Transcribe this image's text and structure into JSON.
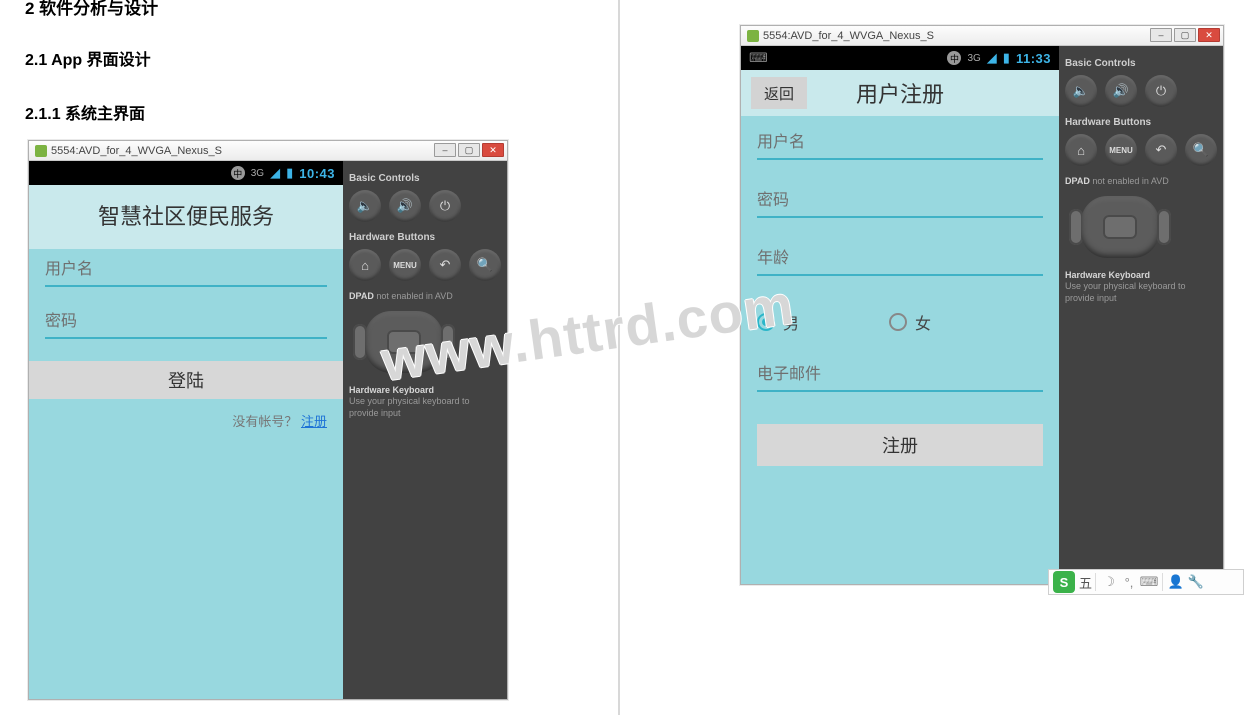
{
  "doc": {
    "section2_partial": "2 软件分析与设计",
    "h21": "2.1 App 界面设计",
    "h211": "2.1.1  系统主界面"
  },
  "emulator": {
    "window_title": "5554:AVD_for_4_WVGA_Nexus_S",
    "basic_controls_label": "Basic Controls",
    "hardware_buttons_label": "Hardware Buttons",
    "dpad_label": "DPAD",
    "dpad_disabled": "not enabled in AVD",
    "hw_kbd_label": "Hardware Keyboard",
    "hw_kbd_hint": "Use your physical keyboard to provide input",
    "menu_btn": "MENU"
  },
  "screen1": {
    "statusbar": {
      "ime": "中",
      "net": "3G",
      "clock": "10:43"
    },
    "title": "智慧社区便民服务",
    "username_ph": "用户名",
    "password_ph": "密码",
    "login_btn": "登陆",
    "no_account": "没有帐号？",
    "register_link": "注册"
  },
  "screen2": {
    "statusbar": {
      "ime": "中",
      "net": "3G",
      "clock": "11:33"
    },
    "back_btn": "返回",
    "title": "用户注册",
    "username_ph": "用户名",
    "password_ph": "密码",
    "age_ph": "年龄",
    "gender_male": "男",
    "gender_female": "女",
    "gender_selected": "male",
    "email_ph": "电子邮件",
    "submit_btn": "注册"
  },
  "watermark": "www.httrd.com",
  "ime_bar": {
    "label": "五",
    "glyphs": [
      "☽",
      "°,",
      ""
    ]
  }
}
